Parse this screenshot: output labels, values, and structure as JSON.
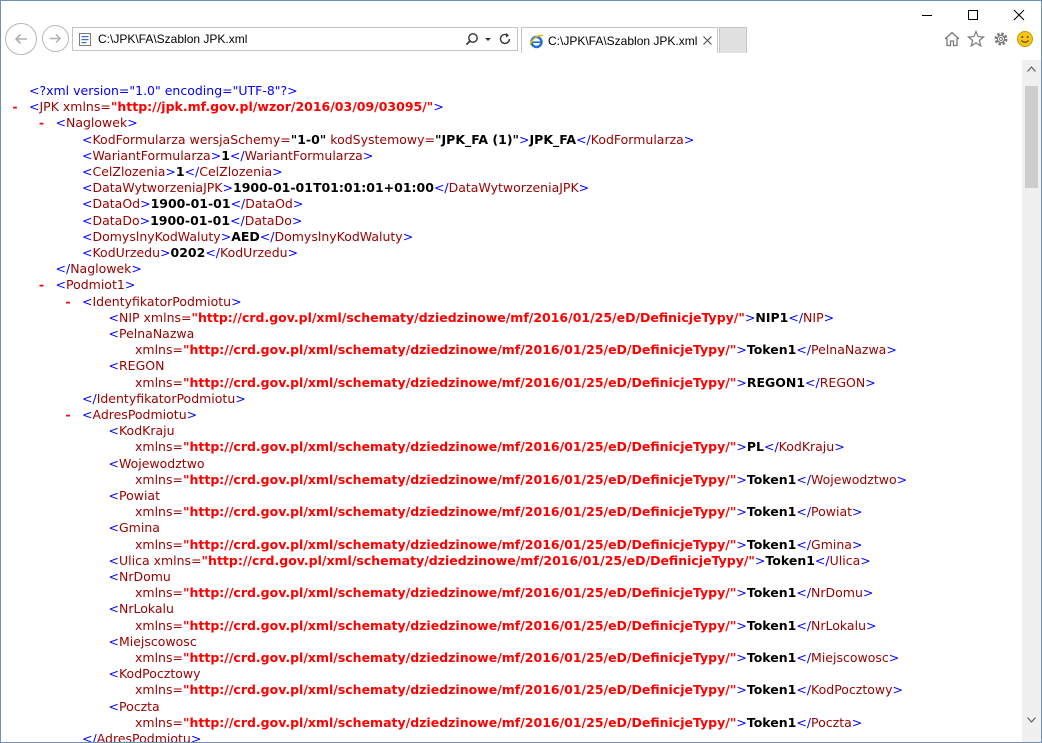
{
  "address_bar": {
    "url": "C:\\JPK\\FA\\Szablon JPK.xml"
  },
  "tab": {
    "title": "C:\\JPK\\FA\\Szablon JPK.xml"
  },
  "xml_lines": [
    {
      "indent": 0,
      "minus": false,
      "parts": [
        {
          "c": "pi",
          "t": "<?xml version=\"1.0\" encoding=\"UTF-8\"?>"
        }
      ]
    },
    {
      "indent": 0,
      "minus": true,
      "parts": [
        {
          "c": "tg",
          "t": "<"
        },
        {
          "c": "ename",
          "t": "JPK xmlns="
        },
        {
          "c": "aval",
          "t": "\"http://jpk.mf.gov.pl/wzor/2016/03/09/03095/\""
        },
        {
          "c": "tg",
          "t": ">"
        }
      ]
    },
    {
      "indent": 1,
      "minus": true,
      "parts": [
        {
          "c": "tg",
          "t": "<"
        },
        {
          "c": "ename",
          "t": "Naglowek"
        },
        {
          "c": "tg",
          "t": ">"
        }
      ]
    },
    {
      "indent": 2,
      "minus": false,
      "parts": [
        {
          "c": "tg",
          "t": "<"
        },
        {
          "c": "ename",
          "t": "KodFormularza wersjaSchemy="
        },
        {
          "c": "txt",
          "t": "\"1-0\""
        },
        {
          "c": "ename",
          "t": " kodSystemowy="
        },
        {
          "c": "txt",
          "t": "\"JPK_FA (1)\""
        },
        {
          "c": "tg",
          "t": ">"
        },
        {
          "c": "txt",
          "t": "JPK_FA"
        },
        {
          "c": "tg",
          "t": "</"
        },
        {
          "c": "ename",
          "t": "KodFormularza"
        },
        {
          "c": "tg",
          "t": ">"
        }
      ]
    },
    {
      "indent": 2,
      "minus": false,
      "parts": [
        {
          "c": "tg",
          "t": "<"
        },
        {
          "c": "ename",
          "t": "WariantFormularza"
        },
        {
          "c": "tg",
          "t": ">"
        },
        {
          "c": "txt",
          "t": "1"
        },
        {
          "c": "tg",
          "t": "</"
        },
        {
          "c": "ename",
          "t": "WariantFormularza"
        },
        {
          "c": "tg",
          "t": ">"
        }
      ]
    },
    {
      "indent": 2,
      "minus": false,
      "parts": [
        {
          "c": "tg",
          "t": "<"
        },
        {
          "c": "ename",
          "t": "CelZlozenia"
        },
        {
          "c": "tg",
          "t": ">"
        },
        {
          "c": "txt",
          "t": "1"
        },
        {
          "c": "tg",
          "t": "</"
        },
        {
          "c": "ename",
          "t": "CelZlozenia"
        },
        {
          "c": "tg",
          "t": ">"
        }
      ]
    },
    {
      "indent": 2,
      "minus": false,
      "parts": [
        {
          "c": "tg",
          "t": "<"
        },
        {
          "c": "ename",
          "t": "DataWytworzeniaJPK"
        },
        {
          "c": "tg",
          "t": ">"
        },
        {
          "c": "txt",
          "t": "1900-01-01T01:01:01+01:00"
        },
        {
          "c": "tg",
          "t": "</"
        },
        {
          "c": "ename",
          "t": "DataWytworzeniaJPK"
        },
        {
          "c": "tg",
          "t": ">"
        }
      ]
    },
    {
      "indent": 2,
      "minus": false,
      "parts": [
        {
          "c": "tg",
          "t": "<"
        },
        {
          "c": "ename",
          "t": "DataOd"
        },
        {
          "c": "tg",
          "t": ">"
        },
        {
          "c": "txt",
          "t": "1900-01-01"
        },
        {
          "c": "tg",
          "t": "</"
        },
        {
          "c": "ename",
          "t": "DataOd"
        },
        {
          "c": "tg",
          "t": ">"
        }
      ]
    },
    {
      "indent": 2,
      "minus": false,
      "parts": [
        {
          "c": "tg",
          "t": "<"
        },
        {
          "c": "ename",
          "t": "DataDo"
        },
        {
          "c": "tg",
          "t": ">"
        },
        {
          "c": "txt",
          "t": "1900-01-01"
        },
        {
          "c": "tg",
          "t": "</"
        },
        {
          "c": "ename",
          "t": "DataDo"
        },
        {
          "c": "tg",
          "t": ">"
        }
      ]
    },
    {
      "indent": 2,
      "minus": false,
      "parts": [
        {
          "c": "tg",
          "t": "<"
        },
        {
          "c": "ename",
          "t": "DomyslnyKodWaluty"
        },
        {
          "c": "tg",
          "t": ">"
        },
        {
          "c": "txt",
          "t": "AED"
        },
        {
          "c": "tg",
          "t": "</"
        },
        {
          "c": "ename",
          "t": "DomyslnyKodWaluty"
        },
        {
          "c": "tg",
          "t": ">"
        }
      ]
    },
    {
      "indent": 2,
      "minus": false,
      "parts": [
        {
          "c": "tg",
          "t": "<"
        },
        {
          "c": "ename",
          "t": "KodUrzedu"
        },
        {
          "c": "tg",
          "t": ">"
        },
        {
          "c": "txt",
          "t": "0202"
        },
        {
          "c": "tg",
          "t": "</"
        },
        {
          "c": "ename",
          "t": "KodUrzedu"
        },
        {
          "c": "tg",
          "t": ">"
        }
      ]
    },
    {
      "indent": 1,
      "minus": false,
      "parts": [
        {
          "c": "tg",
          "t": "</"
        },
        {
          "c": "ename",
          "t": "Naglowek"
        },
        {
          "c": "tg",
          "t": ">"
        }
      ]
    },
    {
      "indent": 1,
      "minus": true,
      "parts": [
        {
          "c": "tg",
          "t": "<"
        },
        {
          "c": "ename",
          "t": "Podmiot1"
        },
        {
          "c": "tg",
          "t": ">"
        }
      ]
    },
    {
      "indent": 2,
      "minus": true,
      "parts": [
        {
          "c": "tg",
          "t": "<"
        },
        {
          "c": "ename",
          "t": "IdentyfikatorPodmiotu"
        },
        {
          "c": "tg",
          "t": ">"
        }
      ]
    },
    {
      "indent": 3,
      "minus": false,
      "parts": [
        {
          "c": "tg",
          "t": "<"
        },
        {
          "c": "ename",
          "t": "NIP xmlns="
        },
        {
          "c": "aval",
          "t": "\"http://crd.gov.pl/xml/schematy/dziedzinowe/mf/2016/01/25/eD/DefinicjeTypy/\""
        },
        {
          "c": "tg",
          "t": ">"
        },
        {
          "c": "txt",
          "t": "NIP1"
        },
        {
          "c": "tg",
          "t": "</"
        },
        {
          "c": "ename",
          "t": "NIP"
        },
        {
          "c": "tg",
          "t": ">"
        }
      ]
    },
    {
      "indent": 3,
      "minus": false,
      "parts": [
        {
          "c": "tg",
          "t": "<"
        },
        {
          "c": "ename",
          "t": "PelnaNazwa"
        }
      ]
    },
    {
      "indent": 4,
      "minus": false,
      "parts": [
        {
          "c": "ename",
          "t": "xmlns="
        },
        {
          "c": "aval",
          "t": "\"http://crd.gov.pl/xml/schematy/dziedzinowe/mf/2016/01/25/eD/DefinicjeTypy/\""
        },
        {
          "c": "tg",
          "t": ">"
        },
        {
          "c": "txt",
          "t": "Token1"
        },
        {
          "c": "tg",
          "t": "</"
        },
        {
          "c": "ename",
          "t": "PelnaNazwa"
        },
        {
          "c": "tg",
          "t": ">"
        }
      ]
    },
    {
      "indent": 3,
      "minus": false,
      "parts": [
        {
          "c": "tg",
          "t": "<"
        },
        {
          "c": "ename",
          "t": "REGON"
        }
      ]
    },
    {
      "indent": 4,
      "minus": false,
      "parts": [
        {
          "c": "ename",
          "t": "xmlns="
        },
        {
          "c": "aval",
          "t": "\"http://crd.gov.pl/xml/schematy/dziedzinowe/mf/2016/01/25/eD/DefinicjeTypy/\""
        },
        {
          "c": "tg",
          "t": ">"
        },
        {
          "c": "txt",
          "t": "REGON1"
        },
        {
          "c": "tg",
          "t": "</"
        },
        {
          "c": "ename",
          "t": "REGON"
        },
        {
          "c": "tg",
          "t": ">"
        }
      ]
    },
    {
      "indent": 2,
      "minus": false,
      "parts": [
        {
          "c": "tg",
          "t": "</"
        },
        {
          "c": "ename",
          "t": "IdentyfikatorPodmiotu"
        },
        {
          "c": "tg",
          "t": ">"
        }
      ]
    },
    {
      "indent": 2,
      "minus": true,
      "parts": [
        {
          "c": "tg",
          "t": "<"
        },
        {
          "c": "ename",
          "t": "AdresPodmiotu"
        },
        {
          "c": "tg",
          "t": ">"
        }
      ]
    },
    {
      "indent": 3,
      "minus": false,
      "parts": [
        {
          "c": "tg",
          "t": "<"
        },
        {
          "c": "ename",
          "t": "KodKraju"
        }
      ]
    },
    {
      "indent": 4,
      "minus": false,
      "parts": [
        {
          "c": "ename",
          "t": "xmlns="
        },
        {
          "c": "aval",
          "t": "\"http://crd.gov.pl/xml/schematy/dziedzinowe/mf/2016/01/25/eD/DefinicjeTypy/\""
        },
        {
          "c": "tg",
          "t": ">"
        },
        {
          "c": "txt",
          "t": "PL"
        },
        {
          "c": "tg",
          "t": "</"
        },
        {
          "c": "ename",
          "t": "KodKraju"
        },
        {
          "c": "tg",
          "t": ">"
        }
      ]
    },
    {
      "indent": 3,
      "minus": false,
      "parts": [
        {
          "c": "tg",
          "t": "<"
        },
        {
          "c": "ename",
          "t": "Wojewodztwo"
        }
      ]
    },
    {
      "indent": 4,
      "minus": false,
      "parts": [
        {
          "c": "ename",
          "t": "xmlns="
        },
        {
          "c": "aval",
          "t": "\"http://crd.gov.pl/xml/schematy/dziedzinowe/mf/2016/01/25/eD/DefinicjeTypy/\""
        },
        {
          "c": "tg",
          "t": ">"
        },
        {
          "c": "txt",
          "t": "Token1"
        },
        {
          "c": "tg",
          "t": "</"
        },
        {
          "c": "ename",
          "t": "Wojewodztwo"
        },
        {
          "c": "tg",
          "t": ">"
        }
      ]
    },
    {
      "indent": 3,
      "minus": false,
      "parts": [
        {
          "c": "tg",
          "t": "<"
        },
        {
          "c": "ename",
          "t": "Powiat"
        }
      ]
    },
    {
      "indent": 4,
      "minus": false,
      "parts": [
        {
          "c": "ename",
          "t": "xmlns="
        },
        {
          "c": "aval",
          "t": "\"http://crd.gov.pl/xml/schematy/dziedzinowe/mf/2016/01/25/eD/DefinicjeTypy/\""
        },
        {
          "c": "tg",
          "t": ">"
        },
        {
          "c": "txt",
          "t": "Token1"
        },
        {
          "c": "tg",
          "t": "</"
        },
        {
          "c": "ename",
          "t": "Powiat"
        },
        {
          "c": "tg",
          "t": ">"
        }
      ]
    },
    {
      "indent": 3,
      "minus": false,
      "parts": [
        {
          "c": "tg",
          "t": "<"
        },
        {
          "c": "ename",
          "t": "Gmina"
        }
      ]
    },
    {
      "indent": 4,
      "minus": false,
      "parts": [
        {
          "c": "ename",
          "t": "xmlns="
        },
        {
          "c": "aval",
          "t": "\"http://crd.gov.pl/xml/schematy/dziedzinowe/mf/2016/01/25/eD/DefinicjeTypy/\""
        },
        {
          "c": "tg",
          "t": ">"
        },
        {
          "c": "txt",
          "t": "Token1"
        },
        {
          "c": "tg",
          "t": "</"
        },
        {
          "c": "ename",
          "t": "Gmina"
        },
        {
          "c": "tg",
          "t": ">"
        }
      ]
    },
    {
      "indent": 3,
      "minus": false,
      "parts": [
        {
          "c": "tg",
          "t": "<"
        },
        {
          "c": "ename",
          "t": "Ulica xmlns="
        },
        {
          "c": "aval",
          "t": "\"http://crd.gov.pl/xml/schematy/dziedzinowe/mf/2016/01/25/eD/DefinicjeTypy/\""
        },
        {
          "c": "tg",
          "t": ">"
        },
        {
          "c": "txt",
          "t": "Token1"
        },
        {
          "c": "tg",
          "t": "</"
        },
        {
          "c": "ename",
          "t": "Ulica"
        },
        {
          "c": "tg",
          "t": ">"
        }
      ]
    },
    {
      "indent": 3,
      "minus": false,
      "parts": [
        {
          "c": "tg",
          "t": "<"
        },
        {
          "c": "ename",
          "t": "NrDomu"
        }
      ]
    },
    {
      "indent": 4,
      "minus": false,
      "parts": [
        {
          "c": "ename",
          "t": "xmlns="
        },
        {
          "c": "aval",
          "t": "\"http://crd.gov.pl/xml/schematy/dziedzinowe/mf/2016/01/25/eD/DefinicjeTypy/\""
        },
        {
          "c": "tg",
          "t": ">"
        },
        {
          "c": "txt",
          "t": "Token1"
        },
        {
          "c": "tg",
          "t": "</"
        },
        {
          "c": "ename",
          "t": "NrDomu"
        },
        {
          "c": "tg",
          "t": ">"
        }
      ]
    },
    {
      "indent": 3,
      "minus": false,
      "parts": [
        {
          "c": "tg",
          "t": "<"
        },
        {
          "c": "ename",
          "t": "NrLokalu"
        }
      ]
    },
    {
      "indent": 4,
      "minus": false,
      "parts": [
        {
          "c": "ename",
          "t": "xmlns="
        },
        {
          "c": "aval",
          "t": "\"http://crd.gov.pl/xml/schematy/dziedzinowe/mf/2016/01/25/eD/DefinicjeTypy/\""
        },
        {
          "c": "tg",
          "t": ">"
        },
        {
          "c": "txt",
          "t": "Token1"
        },
        {
          "c": "tg",
          "t": "</"
        },
        {
          "c": "ename",
          "t": "NrLokalu"
        },
        {
          "c": "tg",
          "t": ">"
        }
      ]
    },
    {
      "indent": 3,
      "minus": false,
      "parts": [
        {
          "c": "tg",
          "t": "<"
        },
        {
          "c": "ename",
          "t": "Miejscowosc"
        }
      ]
    },
    {
      "indent": 4,
      "minus": false,
      "parts": [
        {
          "c": "ename",
          "t": "xmlns="
        },
        {
          "c": "aval",
          "t": "\"http://crd.gov.pl/xml/schematy/dziedzinowe/mf/2016/01/25/eD/DefinicjeTypy/\""
        },
        {
          "c": "tg",
          "t": ">"
        },
        {
          "c": "txt",
          "t": "Token1"
        },
        {
          "c": "tg",
          "t": "</"
        },
        {
          "c": "ename",
          "t": "Miejscowosc"
        },
        {
          "c": "tg",
          "t": ">"
        }
      ]
    },
    {
      "indent": 3,
      "minus": false,
      "parts": [
        {
          "c": "tg",
          "t": "<"
        },
        {
          "c": "ename",
          "t": "KodPocztowy"
        }
      ]
    },
    {
      "indent": 4,
      "minus": false,
      "parts": [
        {
          "c": "ename",
          "t": "xmlns="
        },
        {
          "c": "aval",
          "t": "\"http://crd.gov.pl/xml/schematy/dziedzinowe/mf/2016/01/25/eD/DefinicjeTypy/\""
        },
        {
          "c": "tg",
          "t": ">"
        },
        {
          "c": "txt",
          "t": "Token1"
        },
        {
          "c": "tg",
          "t": "</"
        },
        {
          "c": "ename",
          "t": "KodPocztowy"
        },
        {
          "c": "tg",
          "t": ">"
        }
      ]
    },
    {
      "indent": 3,
      "minus": false,
      "parts": [
        {
          "c": "tg",
          "t": "<"
        },
        {
          "c": "ename",
          "t": "Poczta"
        }
      ]
    },
    {
      "indent": 4,
      "minus": false,
      "parts": [
        {
          "c": "ename",
          "t": "xmlns="
        },
        {
          "c": "aval",
          "t": "\"http://crd.gov.pl/xml/schematy/dziedzinowe/mf/2016/01/25/eD/DefinicjeTypy/\""
        },
        {
          "c": "tg",
          "t": ">"
        },
        {
          "c": "txt",
          "t": "Token1"
        },
        {
          "c": "tg",
          "t": "</"
        },
        {
          "c": "ename",
          "t": "Poczta"
        },
        {
          "c": "tg",
          "t": ">"
        }
      ]
    },
    {
      "indent": 2,
      "minus": false,
      "parts": [
        {
          "c": "tg",
          "t": "</"
        },
        {
          "c": "ename",
          "t": "AdresPodmiotu"
        },
        {
          "c": "tg",
          "t": ">"
        }
      ]
    }
  ]
}
